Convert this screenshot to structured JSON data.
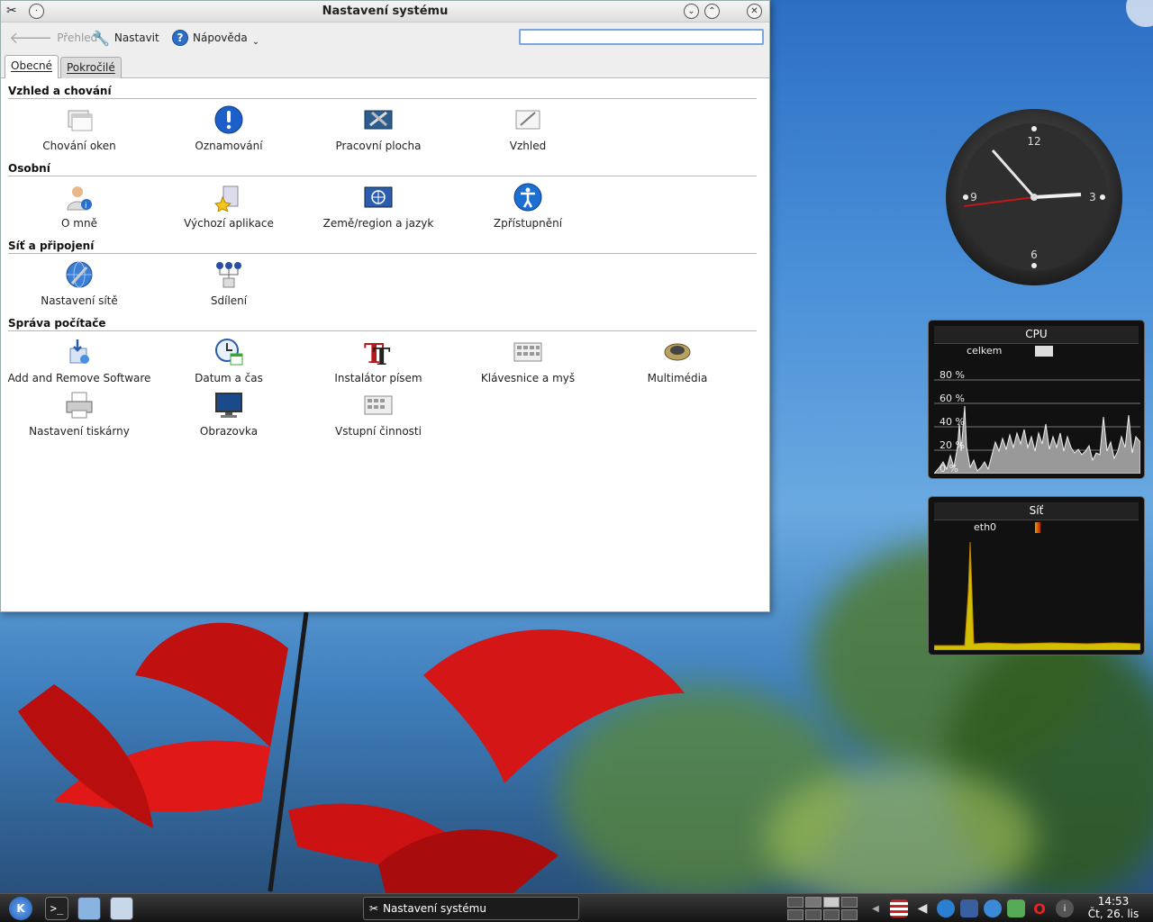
{
  "window": {
    "title": "Nastavení systému",
    "toolbar": {
      "back_label": "Přehled",
      "configure_label": "Nastavit",
      "help_label": "Nápověda",
      "search_value": ""
    },
    "tabs": [
      {
        "label": "Obecné",
        "active": true
      },
      {
        "label": "Pokročilé",
        "active": false
      }
    ],
    "sections": [
      {
        "title": "Vzhled a chování",
        "items": [
          {
            "label": "Chování oken",
            "icon": "window-behavior-icon"
          },
          {
            "label": "Oznamování",
            "icon": "notification-icon"
          },
          {
            "label": "Pracovní plocha",
            "icon": "desktop-icon"
          },
          {
            "label": "Vzhled",
            "icon": "appearance-icon"
          }
        ]
      },
      {
        "title": "Osobní",
        "items": [
          {
            "label": "O mně",
            "icon": "user-icon"
          },
          {
            "label": "Výchozí aplikace",
            "icon": "default-apps-icon"
          },
          {
            "label": "Země/region a jazyk",
            "icon": "locale-flag-icon"
          },
          {
            "label": "Zpřístupnění",
            "icon": "accessibility-icon"
          }
        ]
      },
      {
        "title": "Síť a připojení",
        "items": [
          {
            "label": "Nastavení sítě",
            "icon": "network-settings-icon"
          },
          {
            "label": "Sdílení",
            "icon": "sharing-icon"
          }
        ]
      },
      {
        "title": "Správa počítače",
        "items": [
          {
            "label": "Add and Remove Software",
            "icon": "software-icon"
          },
          {
            "label": "Datum a čas",
            "icon": "clock-calendar-icon"
          },
          {
            "label": "Instalátor písem",
            "icon": "font-installer-icon"
          },
          {
            "label": "Klávesnice a myš",
            "icon": "keyboard-icon"
          },
          {
            "label": "Multimédia",
            "icon": "speaker-icon"
          },
          {
            "label": "Nastavení tiskárny",
            "icon": "printer-icon"
          },
          {
            "label": "Obrazovka",
            "icon": "monitor-icon"
          },
          {
            "label": "Vstupní činnosti",
            "icon": "input-actions-icon"
          }
        ]
      }
    ]
  },
  "clock": {
    "numerals": [
      "12",
      "3",
      "6",
      "9"
    ]
  },
  "cpu_widget": {
    "title": "CPU",
    "label": "celkem",
    "ticks": [
      "80 %",
      "60 %",
      "40 %",
      "20 %",
      "0 %"
    ]
  },
  "net_widget": {
    "title": "Síť",
    "label": "eth0"
  },
  "taskbar": {
    "task_label": "Nastavení systému",
    "time": "14:53",
    "date": "Čt, 26. lis"
  }
}
